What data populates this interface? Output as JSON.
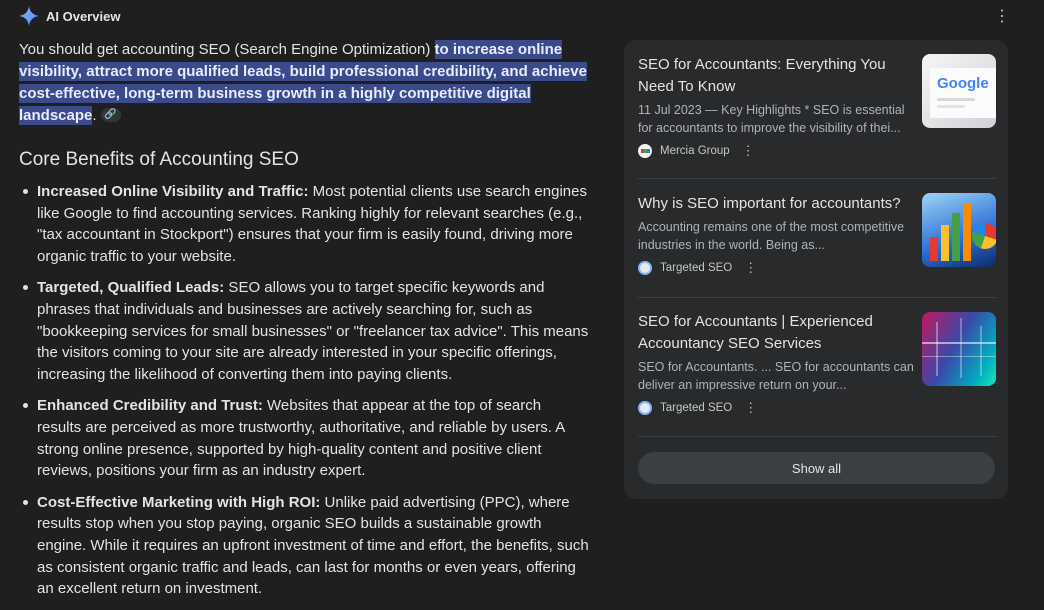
{
  "header": {
    "title": "AI Overview"
  },
  "intro": {
    "plain": "You should get accounting SEO (Search Engine Optimization) ",
    "highlight": "to increase online visibility, attract more qualified leads, build professional credibility, and achieve cost-effective, long-term business growth in a highly competitive digital landscape",
    "end": "."
  },
  "section_title": "Core Benefits of Accounting SEO",
  "benefits": [
    {
      "title": "Increased Online Visibility and Traffic:",
      "text": " Most potential clients use search engines like Google to find accounting services. Ranking highly for relevant searches (e.g., \"tax accountant in Stockport\") ensures that your firm is easily found, driving more organic traffic to your website."
    },
    {
      "title": "Targeted, Qualified Leads:",
      "text": " SEO allows you to target specific keywords and phrases that individuals and businesses are actively searching for, such as \"bookkeeping services for small businesses\" or \"freelancer tax advice\". This means the visitors coming to your site are already interested in your specific offerings, increasing the likelihood of converting them into paying clients."
    },
    {
      "title": "Enhanced Credibility and Trust:",
      "text": " Websites that appear at the top of search results are perceived as more trustworthy, authoritative, and reliable by users. A strong online presence, supported by high-quality content and positive client reviews, positions your firm as an industry expert."
    },
    {
      "title": "Cost-Effective Marketing with High ROI:",
      "text": " Unlike paid advertising (PPC), where results stop when you stop paying, organic SEO builds a sustainable growth engine. While it requires an upfront investment of time and effort, the benefits, such as consistent organic traffic and leads, can last for months or even years, offering an excellent return on investment."
    }
  ],
  "sources": [
    {
      "title": "SEO for Accountants: Everything You Need To Know",
      "snippet": "11 Jul 2023 — Key Highlights * SEO is essential for accountants to improve the visibility of thei...",
      "site": "Mercia Group",
      "thumb_text": "Google"
    },
    {
      "title": "Why is SEO important for accountants?",
      "snippet": "Accounting remains one of the most competitive industries in the world. Being as...",
      "site": "Targeted SEO"
    },
    {
      "title": "SEO for Accountants | Experienced Accountancy SEO Services",
      "snippet": "SEO for Accountants. ... SEO for accountants can deliver an impressive return on your...",
      "site": "Targeted SEO"
    }
  ],
  "show_all_label": "Show all",
  "icons": {
    "header": "sparkle-icon",
    "menu": "more-vert-icon",
    "link": "link-icon"
  },
  "colors": {
    "background": "#1f1f1f",
    "highlight": "#3b4a8a",
    "card": "#282a2c"
  }
}
